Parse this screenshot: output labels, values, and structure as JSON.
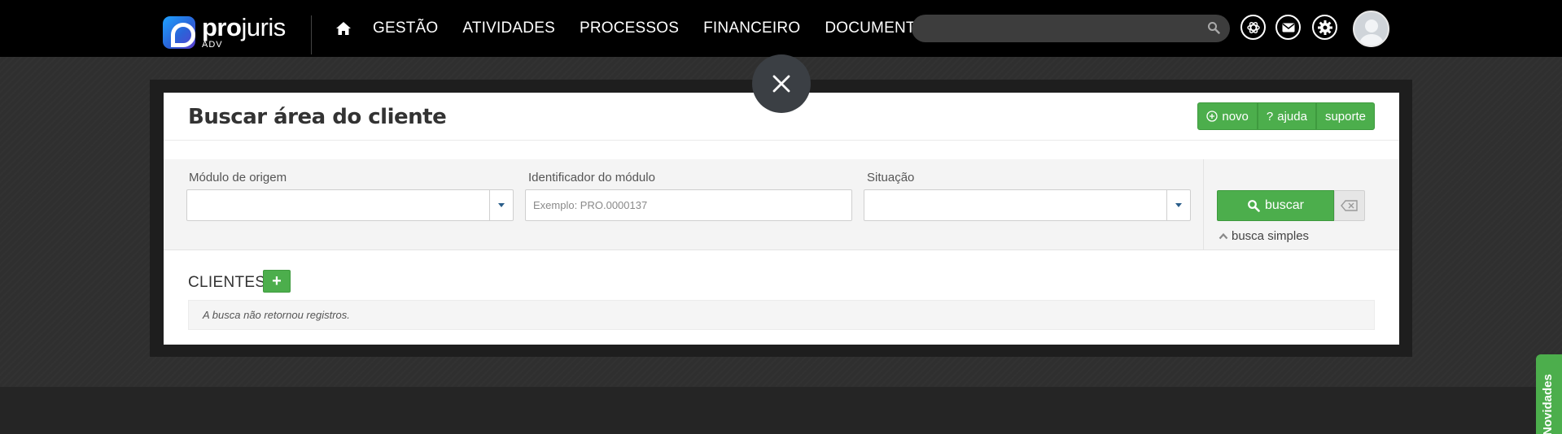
{
  "app": {
    "brand_bold": "pro",
    "brand_light": "juris",
    "brand_sub": "ADV"
  },
  "nav": {
    "items": [
      "GESTÃO",
      "ATIVIDADES",
      "PROCESSOS",
      "FINANCEIRO",
      "DOCUMENTOS"
    ]
  },
  "search": {
    "placeholder": ""
  },
  "modal": {
    "title": "Buscar área do cliente",
    "buttons": {
      "novo": "novo",
      "ajuda": "ajuda",
      "suporte": "suporte"
    },
    "filters": {
      "modulo_label": "Módulo de origem",
      "modulo_value": "",
      "identificador_label": "Identificador do módulo",
      "identificador_placeholder": "Exemplo: PRO.0000137",
      "situacao_label": "Situação",
      "situacao_value": ""
    },
    "buscar_label": "buscar",
    "busca_simples": "busca simples",
    "section_title": "CLIENTES",
    "empty_message": "A busca não retornou registros."
  },
  "side_tab": {
    "label": "Novidades"
  },
  "colors": {
    "accent_green": "#4cae4c",
    "topbar": "#000000",
    "nav_text": "#ffffff"
  }
}
